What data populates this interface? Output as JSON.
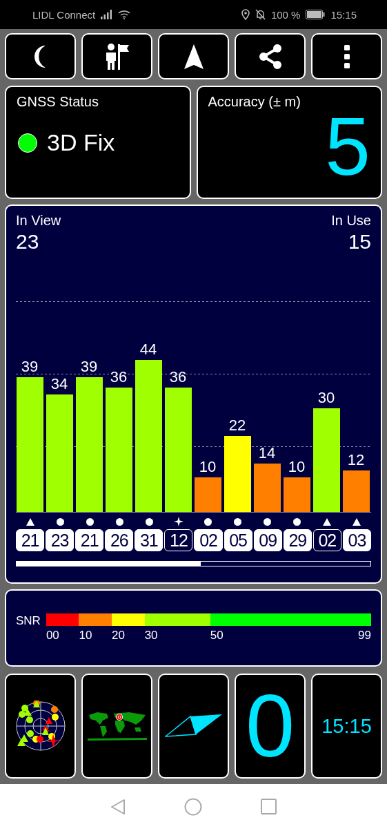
{
  "status_bar": {
    "carrier": "LIDL Connect",
    "battery": "100 %",
    "time": "15:15"
  },
  "toolbar": [
    {
      "kind": "night"
    },
    {
      "kind": "person"
    },
    {
      "kind": "navigate"
    },
    {
      "kind": "share"
    },
    {
      "kind": "more"
    }
  ],
  "gnss_status": {
    "title": "GNSS Status",
    "fix": "3D Fix",
    "color": "#00ff00"
  },
  "accuracy": {
    "title": "Accuracy (± m)",
    "value": "5"
  },
  "satellites_panel": {
    "in_view_label": "In View",
    "in_view": "23",
    "in_use_label": "In Use",
    "in_use": "15",
    "chart_data": {
      "type": "bar",
      "categories": [
        "21",
        "23",
        "21",
        "26",
        "31",
        "12",
        "02",
        "05",
        "09",
        "29",
        "02",
        "03"
      ],
      "series": [
        {
          "values": [
            39,
            34,
            39,
            36,
            44,
            36,
            10,
            22,
            14,
            10,
            30,
            12
          ]
        }
      ],
      "data_labels": true
    },
    "satellites": [
      {
        "kind": "triangle",
        "in_use": true
      },
      {
        "kind": "circle",
        "in_use": true
      },
      {
        "kind": "circle",
        "in_use": true
      },
      {
        "kind": "circle",
        "in_use": true
      },
      {
        "kind": "circle",
        "in_use": true
      },
      {
        "kind": "star",
        "in_use": false
      },
      {
        "kind": "circle",
        "in_use": true
      },
      {
        "kind": "circle",
        "in_use": true
      },
      {
        "kind": "circle",
        "in_use": true
      },
      {
        "kind": "circle",
        "in_use": true
      },
      {
        "kind": "triangle",
        "in_use": false
      },
      {
        "kind": "triangle",
        "in_use": true
      }
    ]
  },
  "snr_legend": {
    "label": "SNR",
    "segments": [
      {
        "from": "00",
        "color": "#ff0000"
      },
      {
        "from": "10",
        "color": "#ff8000"
      },
      {
        "from": "20",
        "color": "#ffff00"
      },
      {
        "from": "30",
        "color": "#a0ff00"
      },
      {
        "from": "50",
        "color": "#00ff00"
      }
    ],
    "max": "99"
  },
  "tiles": [
    {
      "kind": "sky_plot"
    },
    {
      "kind": "world_map"
    },
    {
      "kind": "compass"
    },
    {
      "kind": "number",
      "value": "0"
    },
    {
      "kind": "clock",
      "value": "15:15"
    }
  ]
}
